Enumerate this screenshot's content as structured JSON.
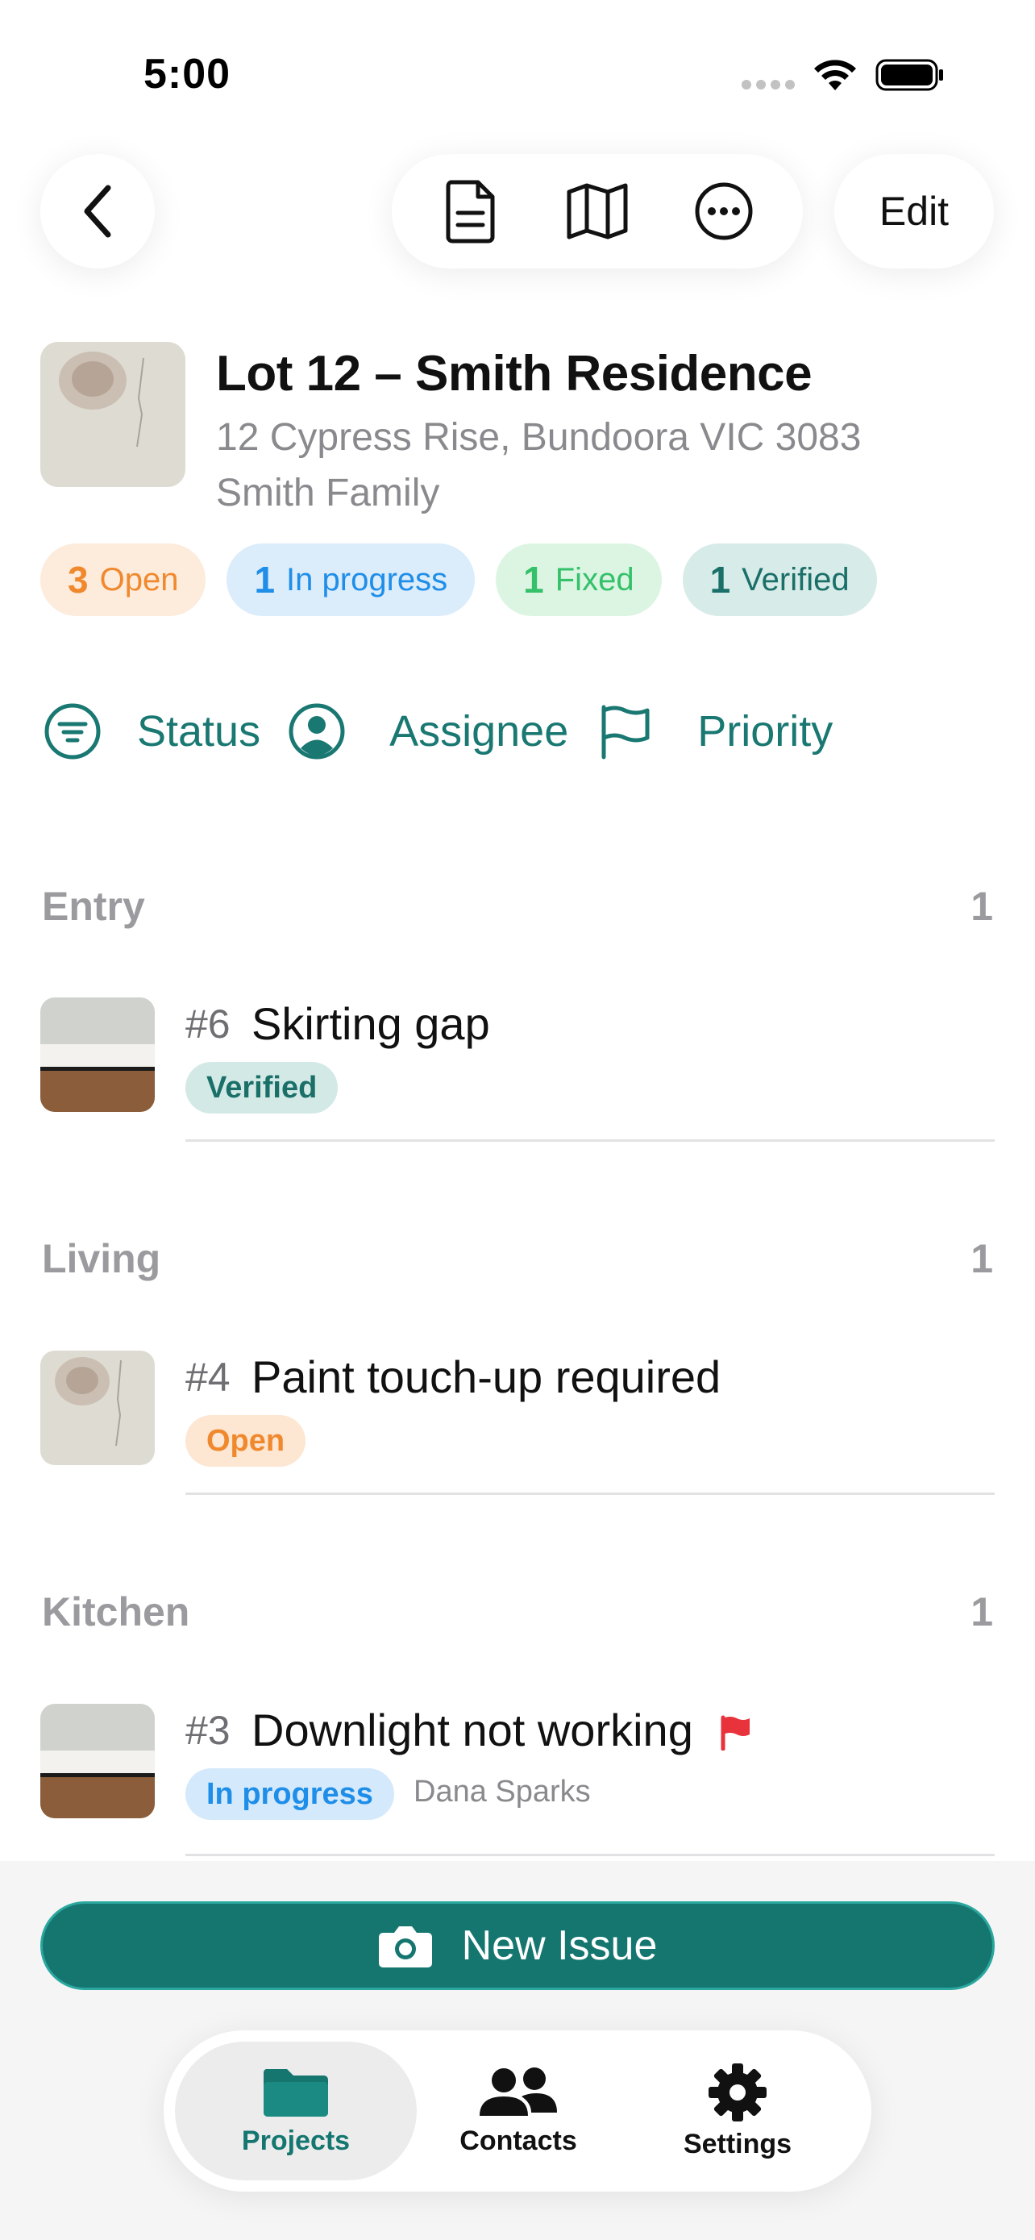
{
  "status_bar": {
    "time": "5:00"
  },
  "toolbar": {
    "back_icon": "chevron-left-icon",
    "document_icon": "document-icon",
    "map_icon": "map-icon",
    "more_icon": "ellipsis-circle-icon",
    "edit_label": "Edit"
  },
  "project": {
    "title": "Lot 12 – Smith Residence",
    "address": "12 Cypress Rise, Bundoora VIC 3083",
    "client": "Smith Family"
  },
  "summary": [
    {
      "count": "3",
      "label": "Open",
      "color": "#f0892e"
    },
    {
      "count": "1",
      "label": "In progress",
      "color": "#1f8ee8"
    },
    {
      "count": "1",
      "label": "Fixed",
      "color": "#35c16a"
    },
    {
      "count": "1",
      "label": "Verified",
      "color": "#1a6f68"
    }
  ],
  "filters": {
    "status_label": "Status",
    "assignee_label": "Assignee",
    "priority_label": "Priority"
  },
  "sections": [
    {
      "name": "Entry",
      "count": "1",
      "issue": {
        "number": "#6",
        "title": "Skirting gap",
        "status": "Verified",
        "assignee": "",
        "flagged": false
      }
    },
    {
      "name": "Living",
      "count": "1",
      "issue": {
        "number": "#4",
        "title": "Paint touch-up required",
        "status": "Open",
        "assignee": "",
        "flagged": false
      }
    },
    {
      "name": "Kitchen",
      "count": "1",
      "issue": {
        "number": "#3",
        "title": "Downlight not working",
        "status": "In progress",
        "assignee": "Dana Sparks",
        "flagged": true
      }
    }
  ],
  "actions": {
    "new_issue_label": "New Issue"
  },
  "tabs": {
    "projects": "Projects",
    "contacts": "Contacts",
    "settings": "Settings"
  },
  "colors": {
    "accent": "#157670",
    "flag": "#e8323c"
  }
}
